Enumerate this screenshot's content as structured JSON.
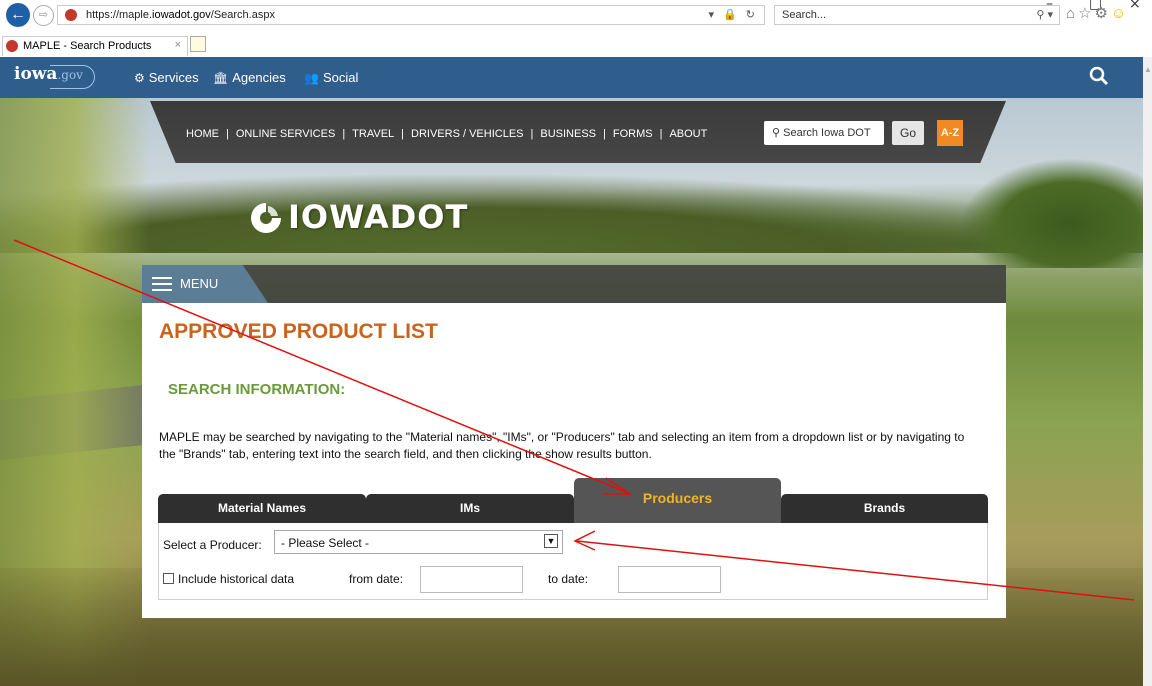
{
  "browser": {
    "url_prefix": "https://maple.",
    "url_domain": "iowadot.gov",
    "url_path": "/Search.aspx",
    "address_tools": "▾ 🔒 ↻",
    "search_placeholder": "Search...",
    "search_tools": "⚲ ▾",
    "tab_title": "MAPLE - Search Products",
    "tab_close": "×",
    "window_controls": [
      "–",
      "□",
      "×"
    ]
  },
  "govbar": {
    "logo_main": "iowa",
    "logo_sub": ".gov",
    "nav": [
      {
        "icon": "⚙",
        "label": "Services"
      },
      {
        "icon": "🏛",
        "label": "Agencies"
      },
      {
        "icon": "👥",
        "label": "Social"
      }
    ]
  },
  "dot_nav": {
    "links": [
      "HOME",
      "ONLINE SERVICES",
      "TRAVEL",
      "DRIVERS / VEHICLES",
      "BUSINESS",
      "FORMS",
      "ABOUT"
    ],
    "separator": "|",
    "search_placeholder": "Search Iowa DOT",
    "go_label": "Go",
    "az_label": "A-Z"
  },
  "logo_wordmark": "IOWADOT",
  "menu_label": "MENU",
  "page_title": "APPROVED PRODUCT LIST",
  "section_heading": "SEARCH INFORMATION:",
  "description": "MAPLE may be searched by navigating to the \"Material names\", \"IMs\", or \"Producers\" tab and selecting an item from a dropdown list or by navigating to the \"Brands\" tab, entering text into the search field, and then clicking the show results button.",
  "tabs": [
    {
      "label": "Material Names",
      "active": false
    },
    {
      "label": "IMs",
      "active": false
    },
    {
      "label": "Producers",
      "active": true
    },
    {
      "label": "Brands",
      "active": false
    }
  ],
  "form": {
    "select_label": "Select a Producer:",
    "select_value": "- Please Select -",
    "historical_label": "Include historical data",
    "historical_checked": false,
    "from_label": "from date:",
    "from_value": "",
    "to_label": "to date:",
    "to_value": ""
  },
  "colors": {
    "title_orange": "#c9641f",
    "heading_green": "#6a9a3c",
    "active_tab_text": "#f0b427",
    "annotation_arrow": "#e01010",
    "govbar_blue": "#2f5d8c"
  }
}
